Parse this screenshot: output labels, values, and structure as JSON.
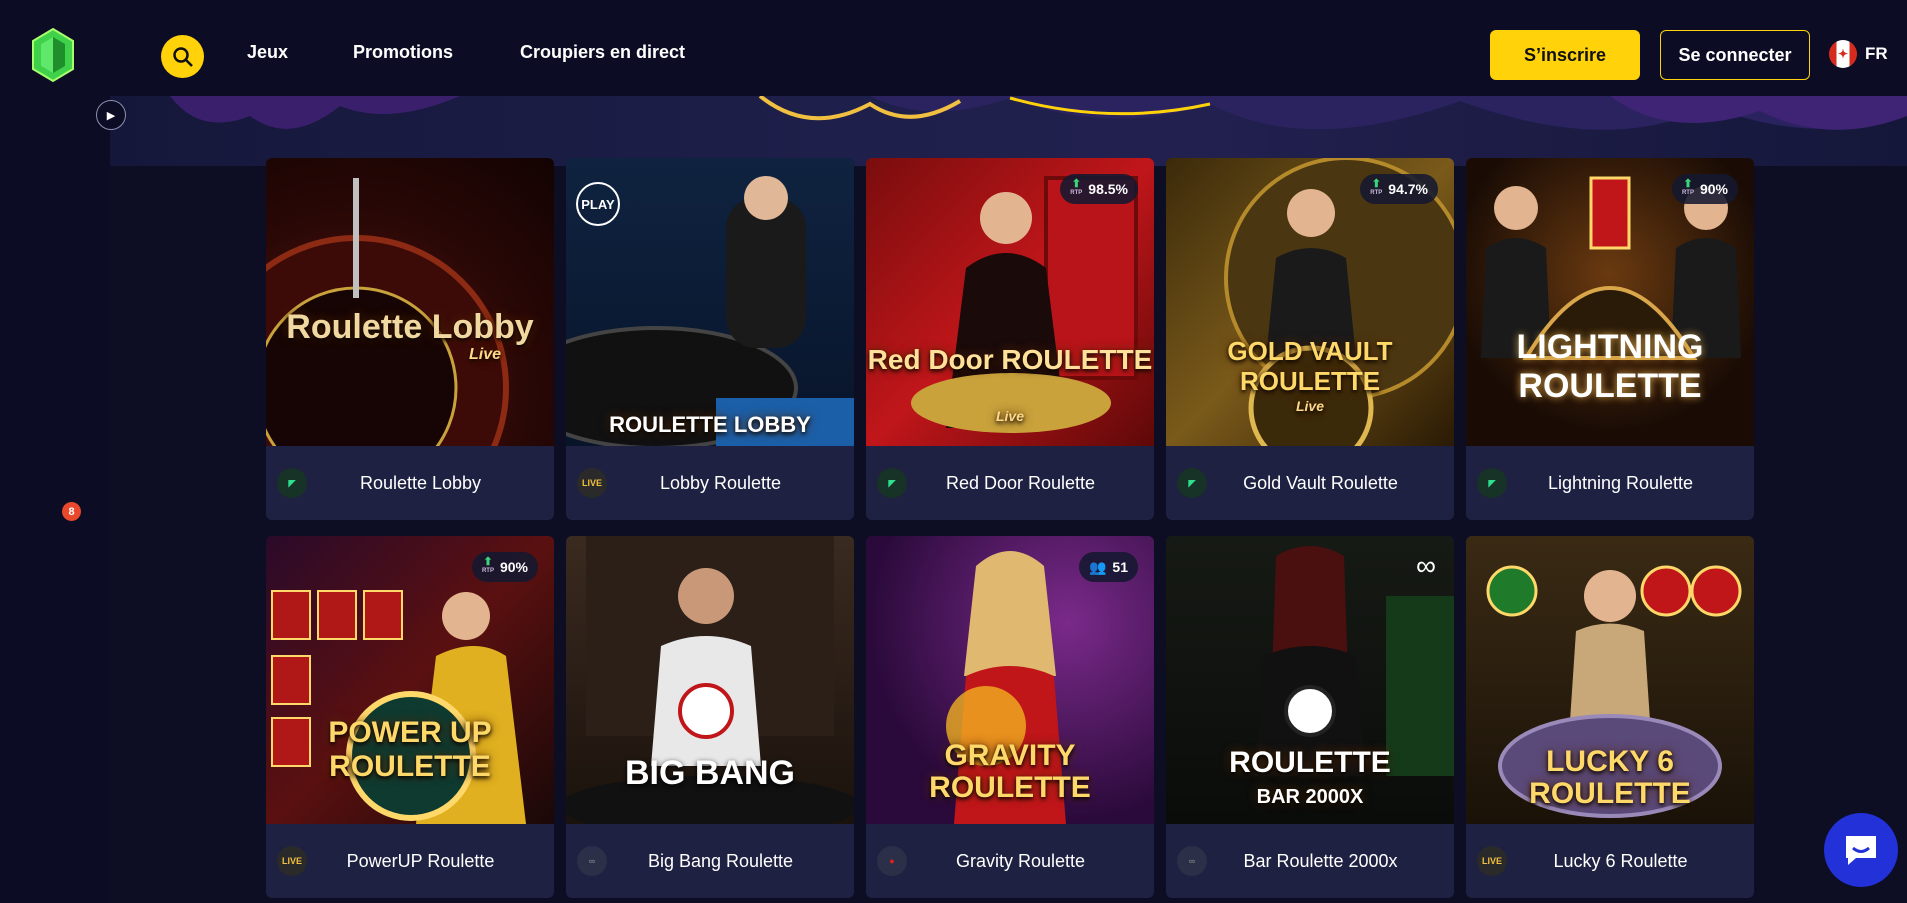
{
  "header": {
    "nav": [
      "Jeux",
      "Promotions",
      "Croupiers en direct"
    ],
    "register_label": "S’inscrire",
    "login_label": "Se connecter",
    "language": "FR"
  },
  "sidebar": {
    "notification_count": "8",
    "icons": [
      "dice-icon",
      "cards-icon",
      "bomb-icon",
      "shield-icon",
      "crown-icon",
      "microphone-icon"
    ]
  },
  "colors": {
    "accent": "#ffd20a",
    "background": "#0d0e24",
    "card": "#1e2141",
    "chat": "#2232d8"
  },
  "games": [
    {
      "name": "Roulette Lobby",
      "art_title": "Roulette Lobby",
      "art_sub": "Live",
      "provider": "green-arrow",
      "rtp": null,
      "art": "lobby1"
    },
    {
      "name": "Lobby Roulette",
      "art_title": "ROULETTE LOBBY",
      "art_sub": "",
      "provider": "live",
      "rtp": null,
      "art": "lobby2",
      "logo_text": "PLAY"
    },
    {
      "name": "Red Door Roulette",
      "art_title": "Red Door ROULETTE",
      "art_sub": "Live",
      "provider": "green-arrow",
      "rtp": "98.5%",
      "art": "reddoor"
    },
    {
      "name": "Gold Vault Roulette",
      "art_title": "GOLD VAULT ROULETTE",
      "art_sub": "Live",
      "provider": "green-arrow",
      "rtp": "94.7%",
      "art": "goldvault"
    },
    {
      "name": "Lightning Roulette",
      "art_title": "LIGHTNING ROULETTE",
      "art_sub": "",
      "provider": "green-arrow",
      "rtp": "90%",
      "art": "lightning"
    },
    {
      "name": "PowerUP Roulette",
      "art_title": "POWER UP ROULETTE",
      "art_sub": "",
      "provider": "live",
      "rtp": "90%",
      "art": "powerup"
    },
    {
      "name": "Big Bang Roulette",
      "art_title": "BIG BANG",
      "art_sub": "",
      "provider": "infinity",
      "rtp": null,
      "art": "bigbang"
    },
    {
      "name": "Gravity Roulette",
      "art_title": "GRAVITY ROULETTE",
      "art_sub": "",
      "provider": "red",
      "rtp": null,
      "players": "51",
      "art": "gravity"
    },
    {
      "name": "Bar Roulette 2000x",
      "art_title": "ROULETTE",
      "art_sub": "BAR 2000X",
      "provider": "infinity",
      "rtp": null,
      "art": "bar"
    },
    {
      "name": "Lucky 6 Roulette",
      "art_title": "LUCKY 6 ROULETTE",
      "art_sub": "",
      "provider": "live",
      "rtp": null,
      "art": "lucky6"
    }
  ],
  "rtp_label": "RTP"
}
